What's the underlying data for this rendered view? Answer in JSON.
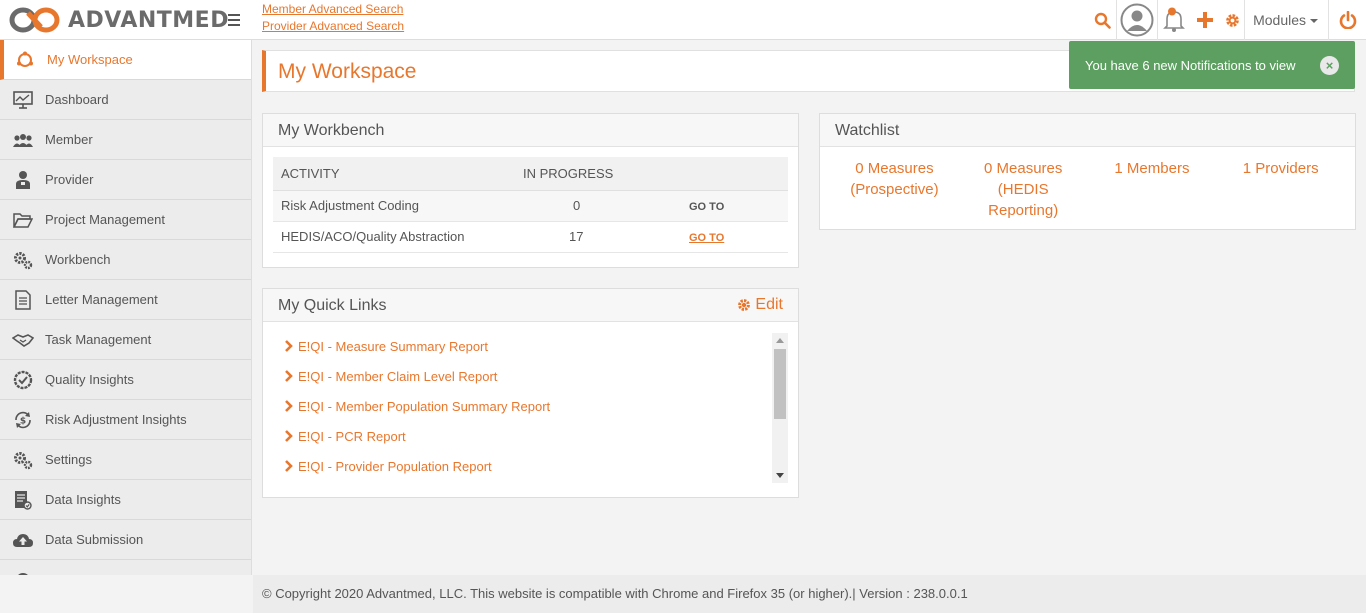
{
  "brand": {
    "name": "ADVANTMED"
  },
  "header": {
    "links": [
      "Member Advanced Search",
      "Provider Advanced Search"
    ],
    "modules_label": "Modules"
  },
  "sidebar": {
    "items": [
      {
        "label": "My Workspace",
        "icon": "workspace-icon",
        "active": true
      },
      {
        "label": "Dashboard",
        "icon": "dashboard-icon"
      },
      {
        "label": "Member",
        "icon": "members-icon"
      },
      {
        "label": "Provider",
        "icon": "provider-icon"
      },
      {
        "label": "Project Management",
        "icon": "folder-icon"
      },
      {
        "label": "Workbench",
        "icon": "gears-icon"
      },
      {
        "label": "Letter Management",
        "icon": "document-icon"
      },
      {
        "label": "Task Management",
        "icon": "handshake-icon"
      },
      {
        "label": "Quality Insights",
        "icon": "quality-check-icon"
      },
      {
        "label": "Risk Adjustment Insights",
        "icon": "risk-dollar-icon"
      },
      {
        "label": "Settings",
        "icon": "gears-icon"
      },
      {
        "label": "Data Insights",
        "icon": "data-insights-icon"
      },
      {
        "label": "Data Submission",
        "icon": "cloud-upload-icon"
      }
    ]
  },
  "page": {
    "title": "My Workspace"
  },
  "toast": {
    "message": "You have 6 new Notifications to view"
  },
  "workbench": {
    "title": "My Workbench",
    "columns": [
      "ACTIVITY",
      "IN PROGRESS",
      ""
    ],
    "rows": [
      {
        "activity": "Risk Adjustment Coding",
        "in_progress": "0",
        "action": "GO TO"
      },
      {
        "activity": "HEDIS/ACO/Quality Abstraction",
        "in_progress": "17",
        "action": "GO TO"
      }
    ]
  },
  "quick_links": {
    "title": "My Quick Links",
    "edit_label": "Edit",
    "items": [
      "E!QI - Measure Summary Report",
      "E!QI - Member Claim Level Report",
      "E!QI - Member Population Summary Report",
      "E!QI - PCR Report",
      "E!QI - Provider Population Report"
    ]
  },
  "watchlist": {
    "title": "Watchlist",
    "items": [
      "0 Measures (Prospective)",
      "0 Measures (HEDIS Reporting)",
      "1 Members",
      "1 Providers"
    ]
  },
  "footer": {
    "text": "© Copyright 2020 Advantmed, LLC. This website is compatible with Chrome and Firefox 35 (or higher).| Version : 238.0.0.1"
  },
  "colors": {
    "accent": "#e8772e",
    "toast_bg": "#5d9f61"
  }
}
